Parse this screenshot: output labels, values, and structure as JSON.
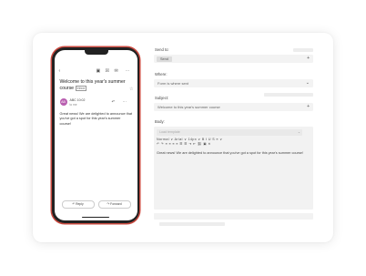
{
  "phone": {
    "subject": "Welcome to this year's summer course",
    "inbox_tag": "Inbox",
    "sender": "ABC  10:02",
    "avatar_initials": "AB",
    "to_line": "to me",
    "body": "Great news! We are delighted to announce that you've got a spot for this year's summer course!",
    "reply_label": "Reply",
    "forward_label": "Forward",
    "icons": {
      "back": "‹",
      "archive": "▣",
      "delete": "☒",
      "mail": "✉",
      "more": "⋯",
      "star": "☆",
      "reply": "↶",
      "reply_arrow": "↶",
      "forward_arrow": "↷"
    }
  },
  "form": {
    "send_to_label": "Send to:",
    "send_to_chip": "Send",
    "where_label": "Where:",
    "where_value": "Form is where sent",
    "subject_label": "Subject:",
    "subject_value": "Welcome to this year's summer course",
    "body_label": "Body:",
    "template_placeholder": "Load template",
    "toolbar_row1": "Normal ∨  Arial ∨  14px ∨   B  I  U  S  ≡ ∨",
    "toolbar_row2": "↶ ↷  ≡ ≡ ≡ ≡  ☰ ☰  ⇥ ⇤  ⛓ ▣  ✕",
    "body_text": "Great news! We are delighted to announce that you've got a spot for this year's summer course!",
    "add_glyph": "+",
    "chevron_glyph": "⌄"
  },
  "colors": {
    "phone_accent": "#c9493f",
    "avatar": "#b95fb0"
  }
}
